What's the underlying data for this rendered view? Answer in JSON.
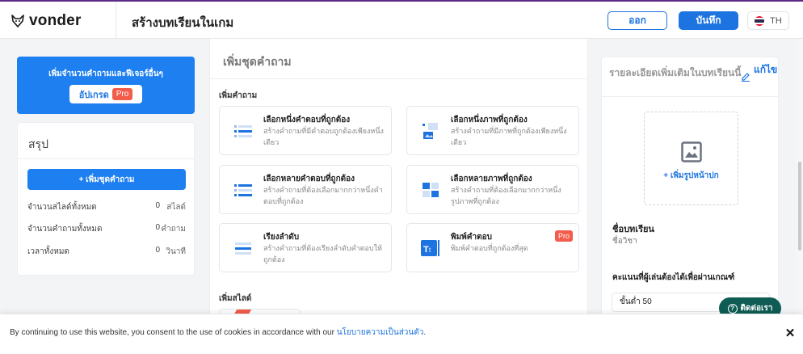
{
  "header": {
    "logo_text": "vonder",
    "page_title": "สร้างบทเรียนในเกม",
    "exit_label": "ออก",
    "save_label": "บันทึก",
    "language": "TH"
  },
  "promo": {
    "text": "เพิ่มจำนวนคำถามและฟีเจอร์อื่นๆ",
    "upgrade_label": "อัปเกรด",
    "pro_badge": "Pro"
  },
  "summary": {
    "title": "สรุป",
    "add_set_label": "+ เพิ่มชุดคำถาม",
    "stats": [
      {
        "label": "จำนวนสไลด์ทั้งหมด",
        "value": "0",
        "unit": "สไลด์"
      },
      {
        "label": "จำนวนคำถามทั้งหมด",
        "value": "0",
        "unit": "คำถาม"
      },
      {
        "label": "เวลาทั้งหมด",
        "value": "0",
        "unit": "วินาที"
      }
    ]
  },
  "middle": {
    "title": "เพิ่มชุดคำถาม",
    "add_question_label": "เพิ่มคำถาม",
    "add_slide_label": "เพิ่มสไลด์",
    "cards": [
      {
        "title": "เลือกหนึ่งคำตอบที่ถูกต้อง",
        "desc": "สร้างคำถามที่มีคำตอบถูกต้องเพียงหนึ่งเดียว"
      },
      {
        "title": "เลือกหนึ่งภาพที่ถูกต้อง",
        "desc": "สร้างคำถามที่มีภาพที่ถูกต้องเพียงหนึ่งเดียว"
      },
      {
        "title": "เลือกหลายคำตอบที่ถูกต้อง",
        "desc": "สร้างคำถามที่ต้องเลือกมากกว่าหนึ่งคำตอบที่ถูกต้อง"
      },
      {
        "title": "เลือกหลายภาพที่ถูกต้อง",
        "desc": "สร้างคำถามที่ต้องเลือกมากกว่าหนึ่งรูปภาพที่ถูกต้อง"
      },
      {
        "title": "เรียงลำดับ",
        "desc": "สร้างคำถามที่ต้องเรียงลำดับคำตอบให้ถูกต้อง"
      },
      {
        "title": "พิมพ์คำตอบ",
        "desc": "พิมพ์คำตอบที่ถูกต้องที่สุด",
        "pro_badge": "Pro"
      }
    ]
  },
  "right": {
    "title": "รายละเอียดเพิ่มเติมในบทเรียนนี้",
    "edit_label": "แก้ไข",
    "cover_label": "+ เพิ่มรูปหน้าปก",
    "lesson_name_label": "ชื่อบทเรียน",
    "subject_label": "ชื่อวิชา",
    "score_label": "คะแนนที่ผู้เล่นต้องได้เพื่อผ่านเกณฑ์",
    "score_value": "ขั้นต่ำ 50"
  },
  "contact": {
    "label": "ติดต่อเรา"
  },
  "cookie": {
    "text": "By continuing to use this website, you consent to the use of cookies in accordance with our ",
    "link": "นโยบายความเป็นส่วนตัว",
    "end": ".",
    "close": "✕"
  },
  "colors": {
    "primary": "#1d74e0",
    "pro": "#f25c4a",
    "contact": "#0e5c53",
    "brand_line": "#5b2a86"
  }
}
